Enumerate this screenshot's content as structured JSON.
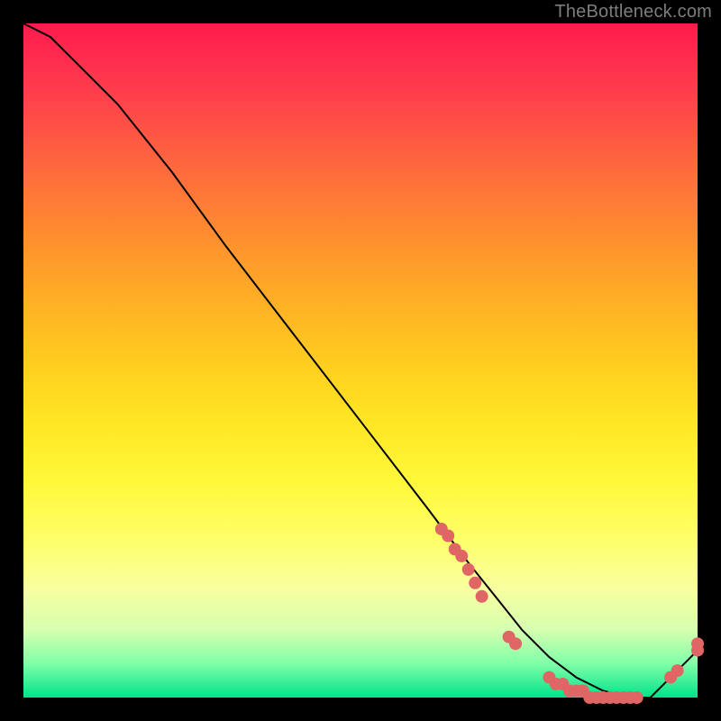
{
  "watermark": "TheBottleneck.com",
  "chart_data": {
    "type": "line",
    "title": "",
    "xlabel": "",
    "ylabel": "",
    "xlim": [
      0,
      100
    ],
    "ylim": [
      0,
      100
    ],
    "series": [
      {
        "name": "bottleneck-curve",
        "x": [
          0,
          4,
          7,
          10,
          14,
          22,
          30,
          40,
          50,
          60,
          66,
          70,
          74,
          78,
          82,
          86,
          90,
          93,
          96,
          100
        ],
        "y": [
          100,
          98,
          95,
          92,
          88,
          78,
          67,
          54,
          41,
          28,
          20,
          15,
          10,
          6,
          3,
          1,
          0,
          0,
          3,
          7
        ]
      }
    ],
    "scatter_highlights": {
      "name": "highlight-dots",
      "color": "#e06666",
      "points": [
        {
          "x": 62,
          "y": 25
        },
        {
          "x": 63,
          "y": 24
        },
        {
          "x": 64,
          "y": 22
        },
        {
          "x": 65,
          "y": 21
        },
        {
          "x": 66,
          "y": 19
        },
        {
          "x": 67,
          "y": 17
        },
        {
          "x": 68,
          "y": 15
        },
        {
          "x": 72,
          "y": 9
        },
        {
          "x": 73,
          "y": 8
        },
        {
          "x": 78,
          "y": 3
        },
        {
          "x": 79,
          "y": 2
        },
        {
          "x": 80,
          "y": 2
        },
        {
          "x": 81,
          "y": 1
        },
        {
          "x": 82,
          "y": 1
        },
        {
          "x": 83,
          "y": 1
        },
        {
          "x": 84,
          "y": 0
        },
        {
          "x": 85,
          "y": 0
        },
        {
          "x": 86,
          "y": 0
        },
        {
          "x": 87,
          "y": 0
        },
        {
          "x": 88,
          "y": 0
        },
        {
          "x": 89,
          "y": 0
        },
        {
          "x": 90,
          "y": 0
        },
        {
          "x": 91,
          "y": 0
        },
        {
          "x": 96,
          "y": 3
        },
        {
          "x": 97,
          "y": 4
        },
        {
          "x": 100,
          "y": 7
        },
        {
          "x": 100,
          "y": 8
        }
      ]
    },
    "gradient_stops": [
      {
        "pct": 0,
        "color": "#ff1a4d"
      },
      {
        "pct": 22,
        "color": "#ff6b3d"
      },
      {
        "pct": 52,
        "color": "#ffd21f"
      },
      {
        "pct": 76,
        "color": "#ffff66"
      },
      {
        "pct": 95,
        "color": "#7fffa8"
      },
      {
        "pct": 100,
        "color": "#00e38a"
      }
    ]
  }
}
